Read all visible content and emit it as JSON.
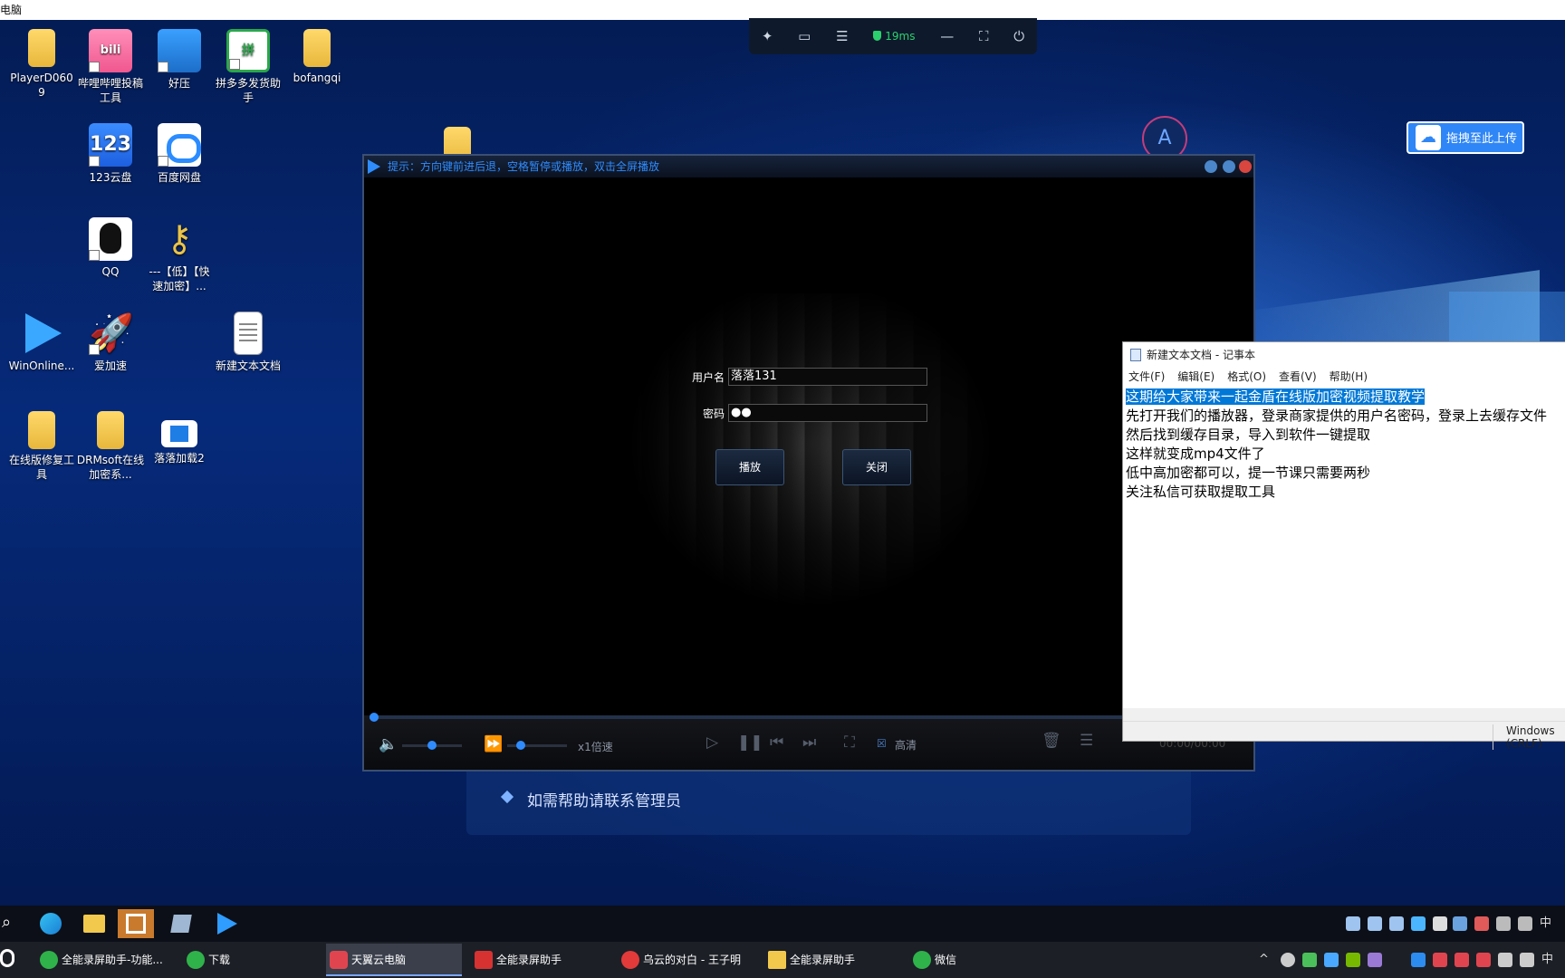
{
  "top_strip_text": "电脑",
  "rdp_toolbar": {
    "ping": "19ms"
  },
  "upload_button": "拖拽至此上传",
  "desktop_icons": [
    {
      "label": "PlayerD0609"
    },
    {
      "label": "哔哩哔哩投稿工具"
    },
    {
      "label": "好压"
    },
    {
      "label": "拼多多发货助手"
    },
    {
      "label": "bofangqi"
    },
    {
      "label": "123云盘"
    },
    {
      "label": "百度网盘"
    },
    {
      "label": "QQ"
    },
    {
      "label": "---【低】【快速加密】..."
    },
    {
      "label": "WinOnline..."
    },
    {
      "label": "爱加速"
    },
    {
      "label": "新建文本文档"
    },
    {
      "label": "在线版修复工具"
    },
    {
      "label": "DRMsoft在线加密系..."
    },
    {
      "label": "落落加载2"
    }
  ],
  "background_card_text": "如需帮助请联系管理员",
  "player": {
    "title_hint": "提示：方向键前进后退，空格暂停或播放，双击全屏播放",
    "username_label": "用户名",
    "username_value": "落落131",
    "password_label": "密码",
    "password_value": "●●",
    "play_button": "播放",
    "close_button": "关闭",
    "speed_label": "x1倍速",
    "hd_label": "高清",
    "time": "00:00/00:00"
  },
  "notepad": {
    "title": "新建文本文档 - 记事本",
    "menu": [
      "文件(F)",
      "编辑(E)",
      "格式(O)",
      "查看(V)",
      "帮助(H)"
    ],
    "lines": [
      "这期给大家带来一起金盾在线版加密视频提取教学",
      "先打开我们的播放器，登录商家提供的用户名密码，登录上去缓存文件",
      "然后找到缓存目录，导入到软件一键提取",
      "这样就变成mp4文件了",
      "低中高加密都可以，提一节课只需要两秒",
      "关注私信可获取提取工具"
    ],
    "status": "Windows (CRLF)"
  },
  "taskbar_tasks": [
    {
      "label": "全能录屏助手-功能..."
    },
    {
      "label": "下载"
    },
    {
      "label": "天翼云电脑"
    },
    {
      "label": "全能录屏助手"
    },
    {
      "label": "乌云的对白 - 王子明"
    },
    {
      "label": "全能录屏助手"
    },
    {
      "label": "微信"
    }
  ],
  "tray_ime": "中"
}
